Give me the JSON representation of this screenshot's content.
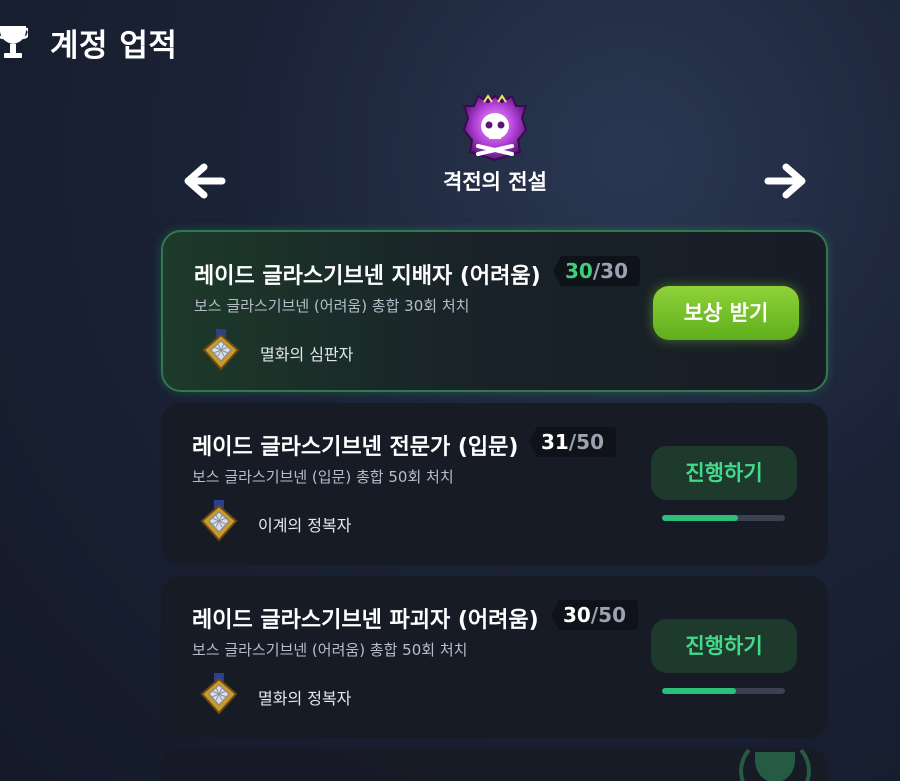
{
  "header": {
    "title": "계정 업적",
    "icon": "trophy-icon"
  },
  "category": {
    "title": "격전의 전설",
    "emblem": "demon-skull-emblem-icon",
    "prev_icon": "arrow-left-icon",
    "next_icon": "arrow-right-icon"
  },
  "achievements": [
    {
      "name": "레이드 글라스기브넨 지배자 (어려움)",
      "current": "30",
      "total": "/30",
      "description": "보스 글라스기브넨 (어려움) 총합 30회 처치",
      "reward_icon": "medal-icon",
      "reward": "멸화의 심판자",
      "button": "보상 받기",
      "status": "complete",
      "progress": 1.0
    },
    {
      "name": "레이드 글라스기브넨 전문가 (입문)",
      "current": "31",
      "total": "/50",
      "description": "보스 글라스기브넨 (입문) 총합 50회 처치",
      "reward_icon": "medal-icon",
      "reward": "이계의 정복자",
      "button": "진행하기",
      "status": "in-progress",
      "progress": 0.62
    },
    {
      "name": "레이드 글라스기브넨 파괴자 (어려움)",
      "current": "30",
      "total": "/50",
      "description": "보스 글라스기브넨 (어려움) 총합 50회 처치",
      "reward_icon": "medal-icon",
      "reward": "멸화의 정복자",
      "button": "진행하기",
      "status": "in-progress",
      "progress": 0.6
    }
  ],
  "colors": {
    "accent_green": "#43d98a",
    "claim_button": "#7cc52d",
    "card_bg": "#171b26",
    "background": "#1a2236"
  }
}
